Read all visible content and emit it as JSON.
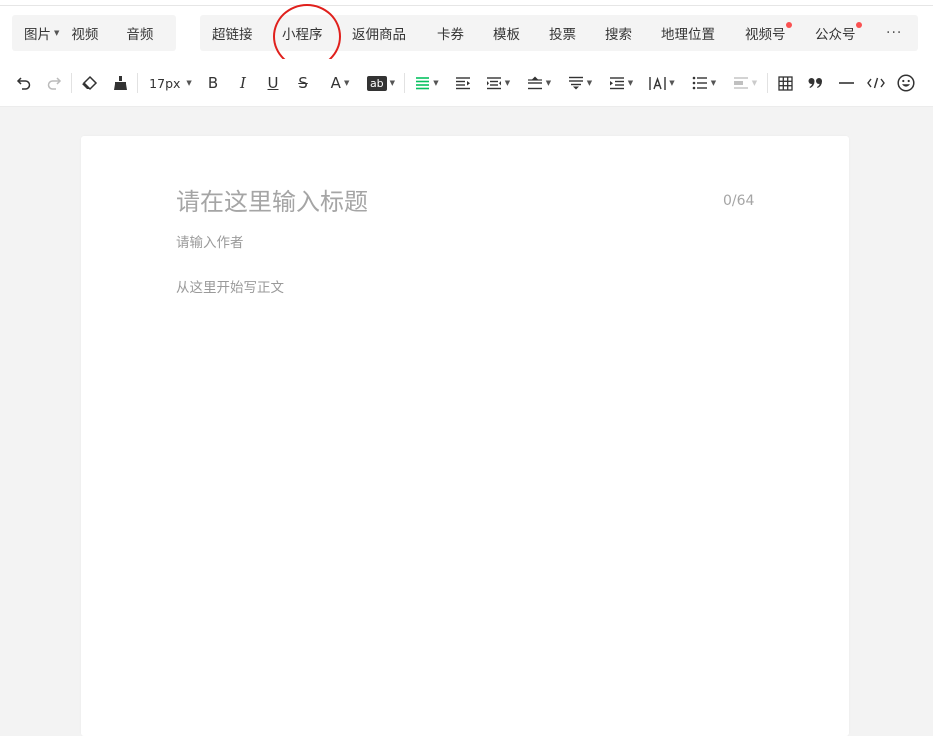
{
  "insert_bar": {
    "media_items": [
      {
        "label": "图片",
        "has_dropdown": true
      },
      {
        "label": "视频"
      },
      {
        "label": "音频"
      }
    ],
    "tool_items": [
      {
        "label": "超链接"
      },
      {
        "label": "小程序",
        "highlighted": true
      },
      {
        "label": "返佣商品"
      },
      {
        "label": "卡券"
      },
      {
        "label": "模板"
      },
      {
        "label": "投票"
      },
      {
        "label": "搜索"
      },
      {
        "label": "地理位置"
      },
      {
        "label": "视频号",
        "badge": true
      },
      {
        "label": "公众号",
        "badge": true
      }
    ],
    "more_icon": "more-horizontal-icon",
    "badge_color": "#fa5151",
    "annotation_color": "#e0201c"
  },
  "format_toolbar": {
    "font_size": "17px",
    "accent_color": "#07c160",
    "icons": [
      "undo-icon",
      "redo-icon",
      "eraser-icon",
      "format-painter-icon",
      "font-size-select",
      "bold-icon",
      "italic-icon",
      "underline-icon",
      "strikethrough-icon",
      "font-color-icon",
      "background-color-icon",
      "align-left-icon",
      "indent-icon",
      "align-justify-icon",
      "line-height-icon",
      "paragraph-spacing-icon",
      "list-indent-icon",
      "letter-spacing-icon",
      "bullet-list-icon",
      "clear-format-icon",
      "table-icon",
      "quote-icon",
      "divider-icon",
      "code-icon",
      "emoji-icon"
    ],
    "bold_glyph": "B",
    "italic_glyph": "I",
    "underline_glyph": "U",
    "strike_glyph": "S",
    "font_color_glyph": "A",
    "bg_color_glyph": "ab"
  },
  "editor": {
    "title_placeholder": "请在这里输入标题",
    "title_counter": "0/64",
    "author_placeholder": "请输入作者",
    "body_placeholder": "从这里开始写正文"
  }
}
